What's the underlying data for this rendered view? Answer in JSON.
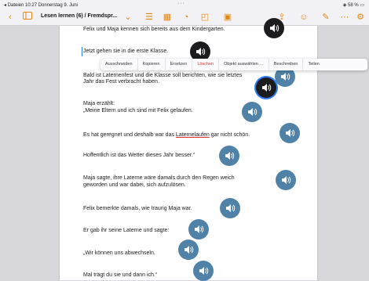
{
  "status": {
    "left": "◂ Dateien  10:27  Donnerstag 9. Juni",
    "center": "···",
    "right": "◈ 58 % ▭"
  },
  "toolbar": {
    "title": "Lesen lernen (6) / Fremdspr...",
    "accent": "#e8850c"
  },
  "menu": {
    "items": [
      "Ausschneiden",
      "Kopieren",
      "Ersetzen",
      "Löschen",
      "Objekt auswählen …",
      "Beschreiben",
      "Teilen"
    ]
  },
  "doc": {
    "lines": [
      "Felix und Maja kennen sich bereits aus dem Kindergarten.",
      "Jetzt gehen sie in die erste Klasse.",
      "Bald ist Laternenfest und die Klasse soll berichten, wie sie letztes",
      "Jahr das Fest verbracht haben.",
      "Maja erzählt:",
      "„Meine Eltern und ich sind mit Felix gelaufen.",
      "Es hat geregnet und deshalb war das ",
      "Laternelaufen",
      " gar nicht schön.",
      "Hoffentlich ist das Wetter dieses Jahr besser.“",
      "Maja sagte, ihre Laterne wäre damals durch den Regen weich",
      "geworden und war dabei, sich aufzulösen.",
      "Felix bemerkte damals, wie traurig Maja war.",
      "Er gab ihr seine Laterne und sagte:",
      "„Wir können uns abwechseln.",
      "Mal trägt du sie und dann ich.“"
    ]
  },
  "colors": {
    "speaker": "#4f82a6",
    "speaker_dark": "#1c1c1e",
    "delete": "#e0302a"
  }
}
